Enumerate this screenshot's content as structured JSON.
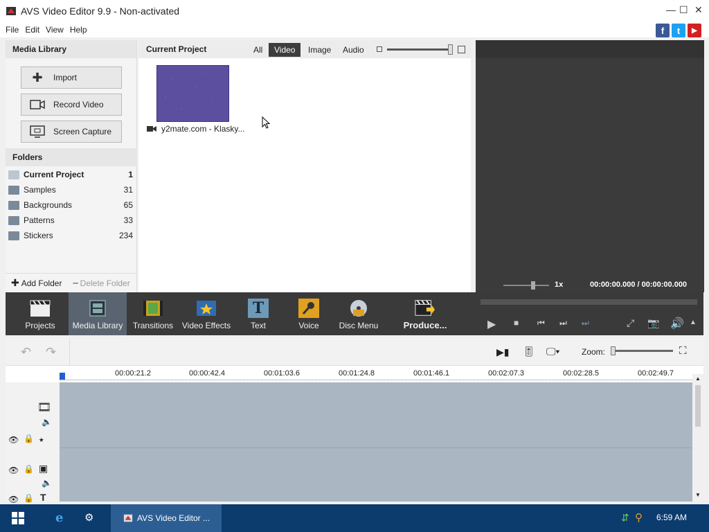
{
  "window": {
    "title": "AVS Video Editor 9.9 - Non-activated"
  },
  "menu": [
    "File",
    "Edit",
    "View",
    "Help"
  ],
  "social": {
    "facebook": "f",
    "twitter": "t",
    "youtube": "▶"
  },
  "media_library": {
    "title": "Media Library",
    "buttons": [
      {
        "label": "Import",
        "icon": "plus-icon"
      },
      {
        "label": "Record Video",
        "icon": "camera-icon"
      },
      {
        "label": "Screen Capture",
        "icon": "screen-capture-icon"
      }
    ],
    "folders_title": "Folders",
    "folders": [
      {
        "name": "Current Project",
        "count": "1"
      },
      {
        "name": "Samples",
        "count": "31"
      },
      {
        "name": "Backgrounds",
        "count": "65"
      },
      {
        "name": "Patterns",
        "count": "33"
      },
      {
        "name": "Stickers",
        "count": "234"
      }
    ],
    "add_folder": "Add Folder",
    "delete_folder": "Delete Folder"
  },
  "project": {
    "title": "Current Project",
    "filters": [
      "All",
      "Video",
      "Image",
      "Audio"
    ],
    "active_filter": "Video",
    "item_label": "y2mate.com - Klasky..."
  },
  "preview": {
    "speed": "1x",
    "time": "00:00:00.000 / 00:00:00.000"
  },
  "tools": [
    {
      "label": "Projects"
    },
    {
      "label": "Media Library"
    },
    {
      "label": "Transitions"
    },
    {
      "label": "Video Effects"
    },
    {
      "label": "Text"
    },
    {
      "label": "Voice"
    },
    {
      "label": "Disc Menu"
    },
    {
      "label": "Produce..."
    }
  ],
  "timeline": {
    "zoom_label": "Zoom:",
    "ruler": [
      "00:00:21.2",
      "00:00:42.4",
      "00:01:03.6",
      "00:01:24.8",
      "00:01:46.1",
      "00:02:07.3",
      "00:02:28.5",
      "00:02:49.7"
    ]
  },
  "taskbar": {
    "app_label": "AVS Video Editor ...",
    "clock": "6:59 AM"
  },
  "colors": {
    "accent": "#3a4aa0",
    "toolbar_bg": "#3a3a3a",
    "taskbar_bg": "#0c3b6e",
    "timeline_bg": "#aab6c2",
    "thumb": "#5d4fa0"
  }
}
